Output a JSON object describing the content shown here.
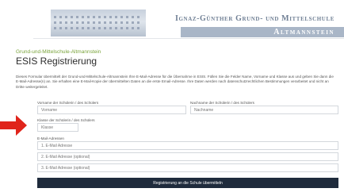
{
  "header": {
    "title": "Ignaz-Günther Grund- und Mittelschule",
    "subtitle": "Altmannstein"
  },
  "breadcrumb": "Grund-und-Mittelschule-Altmannstein",
  "page_title": "ESIS Registrierung",
  "intro": "Dieses Formular übermittelt der Grund-und-Mittelschule-Altmannstein Ihre E-Mail-Adresse für die Übernahme in ESIS. Füllen Sie die Felder Name, Vorname und Klasse aus und geben Sie dann die E-Mail-Adresse(n) an. Sie erhalten eine E-Mail-Kopie der übermittelten Daten an die erste Email-Adresse. Ihre Daten werden nach datenschutzrechtlichen Bestimmungen verarbeitet und nicht an Dritte weitergeleitet.",
  "form": {
    "vorname_label": "Vorname der Schülerin / des Schülers",
    "vorname_placeholder": "Vorname",
    "nachname_label": "Nachname der Schülerin / des Schülers",
    "nachname_placeholder": "Nachname",
    "klasse_label": "Klasse der Schülerin / des Schülers",
    "klasse_placeholder": "Klasse",
    "email_label": "E-Mail-Adressen",
    "email1_placeholder": "1. E-Mail Adresse",
    "email2_placeholder": "2. E-Mail Adresse (optional)",
    "email3_placeholder": "3. E-Mail Adresse (optional)",
    "submit_label": "Registrierung an die Schule übermitteln"
  },
  "colors": {
    "accent_green": "#79a33a",
    "submit_bg": "#1f2b3c",
    "arrow": "#e0241b",
    "header_band": "#a9b6c7"
  }
}
